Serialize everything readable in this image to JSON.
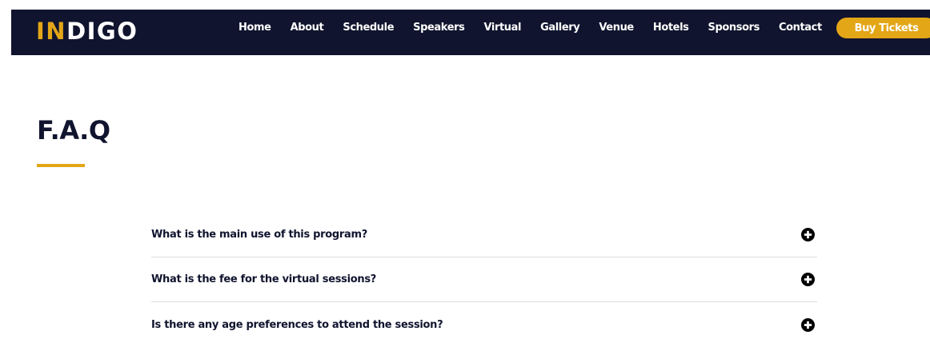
{
  "header": {
    "logo_accent": "IN",
    "logo_rest": "DIGO",
    "nav": [
      {
        "label": "Home"
      },
      {
        "label": "About"
      },
      {
        "label": "Schedule"
      },
      {
        "label": "Speakers"
      },
      {
        "label": "Virtual"
      },
      {
        "label": "Gallery"
      },
      {
        "label": "Venue"
      },
      {
        "label": "Hotels"
      },
      {
        "label": "Sponsors"
      },
      {
        "label": "Contact"
      }
    ],
    "buy_label": "Buy Tickets"
  },
  "faq": {
    "title": "F.A.Q",
    "items": [
      {
        "question": "What is the main use of this program?",
        "icon": "plus-circle-icon"
      },
      {
        "question": "What is the fee for the virtual sessions?",
        "icon": "plus-circle-icon"
      },
      {
        "question": "Is there any age preferences to attend the session?",
        "icon": "plus-circle-icon"
      }
    ]
  },
  "colors": {
    "navbar_bg": "#10142e",
    "accent": "#e3a617",
    "heading": "#10142e"
  }
}
